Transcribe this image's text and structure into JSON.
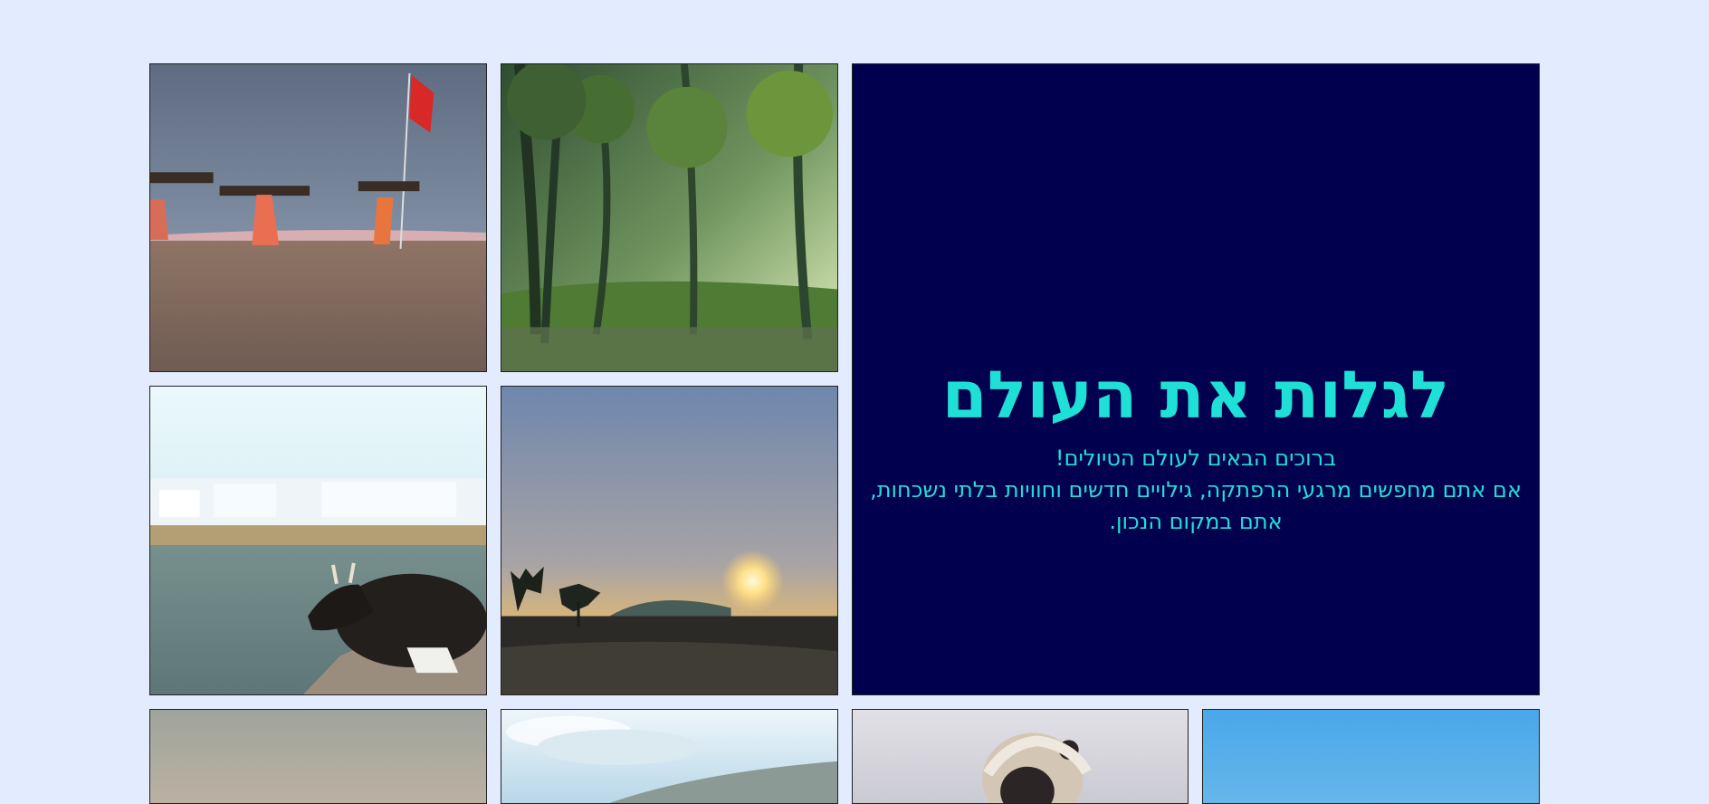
{
  "hero": {
    "title": "לגלות את העולם",
    "lines": [
      "ברוכים הבאים לעולם הטיולים!",
      "אם אתם מחפשים מרגעי הרפתקה, גילויים חדשים וחוויות בלתי נשכחות,",
      "אתם במקום הנכון."
    ]
  },
  "colors": {
    "page_background": "#e3ecff",
    "hero_background": "#00004f",
    "hero_text": "#1fe0d6"
  }
}
